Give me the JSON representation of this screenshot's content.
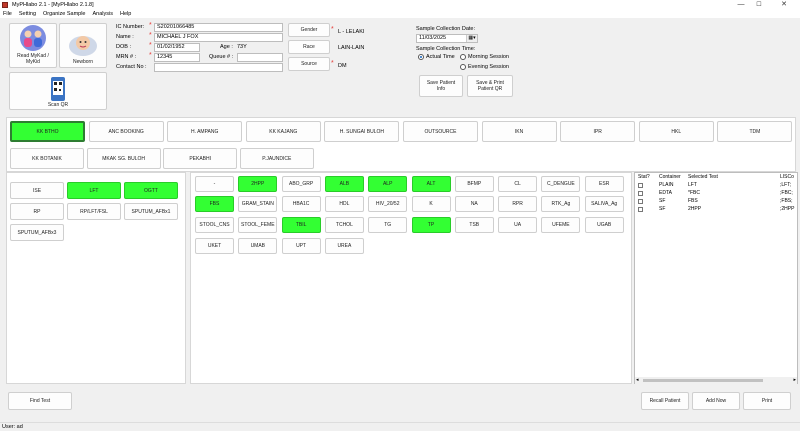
{
  "window": {
    "title": "MyPHlabo 2.1 - [MyPHlabo 2.1.8]",
    "controls": {
      "minimize": "—",
      "maximize": "☐",
      "close": "✕"
    }
  },
  "menu": [
    "File",
    "Setting",
    "Organize Sample",
    "Analysis",
    "Help"
  ],
  "top_buttons": {
    "read_mykad": "Read MyKad / MyKid",
    "newborn": "Newborn",
    "scan_qr": "Scan QR"
  },
  "patient": {
    "ic_label": "IC Number:",
    "ic_value": "S20201066485",
    "name_label": "Name :",
    "name_value": "MICHAEL J FOX",
    "dob_label": "DOB :",
    "dob_value": "01/02/1952",
    "age_label": "Age :",
    "age_value": "73Y",
    "mrn_label": "MRN # :",
    "mrn_value": "12345",
    "queue_label": "Queue # :",
    "queue_value": "",
    "contact_label": "Contact No :",
    "contact_value": ""
  },
  "demographics": {
    "gender_button": "Gender",
    "gender_value": "L - LELAKI",
    "race_button": "Race",
    "race_value": "LAIN-LAIN",
    "source_button": "Source",
    "source_value": "DM"
  },
  "collection": {
    "date_label": "Sample Collection Date:",
    "date_value": "11/03/2025",
    "time_label": "Sample Collection Time:",
    "options": [
      "Actual Time",
      "Morning Session",
      "Evening Session"
    ],
    "selected": "Actual Time"
  },
  "actions": {
    "save_patient": "Save Patient Info",
    "save_print": "Save & Print Patient QR"
  },
  "locations_row1": [
    "KK BTHO",
    "ANC BOOKING",
    "H. AMPANG",
    "KK KAJANG",
    "H. SUNGAI BULOH",
    "OUTSOURCE",
    "IKN",
    "IPR",
    "HKL",
    "TDM"
  ],
  "locations_row2": [
    "KK BOTANIK",
    "MKAK SG. BULOH",
    "PEKABHI",
    "P.JAUNDICE"
  ],
  "selected_location": "KK BTHO",
  "left_tests": [
    "ISE",
    "LFT",
    "OGTT",
    "RP",
    "RP/LFT/FSL",
    "SPUTUM_AFBx1",
    "SPUTUM_AFBx3"
  ],
  "left_tests_selected": [
    "LFT",
    "OGTT"
  ],
  "tests": [
    [
      "-",
      "2HPP",
      "ABO_GRP",
      "ALB",
      "ALP",
      "ALT",
      "BFMP",
      "CL",
      "C_DENGUE",
      "ESR"
    ],
    [
      "FBS",
      "GRAM_STAIN",
      "HBA1C",
      "HDL",
      "HIV_20/52",
      "K",
      "NA",
      "RPR",
      "RTK_Ag",
      "SALIVA_Ag"
    ],
    [
      "STOOL_CNS",
      "STOOL_FEME",
      "TBIL",
      "TCHOL",
      "TG",
      "TP",
      "TSB",
      "UA",
      "UFEME",
      "UGAB"
    ],
    [
      "UKET",
      "UMAB",
      "UPT",
      "UREA"
    ]
  ],
  "tests_selected": [
    "2HPP",
    "ALB",
    "ALP",
    "ALT",
    "FBS",
    "TBIL",
    "TP"
  ],
  "selected_table": {
    "headers": [
      "Stat?",
      "Container",
      "Selected Test",
      "LISCo"
    ],
    "rows": [
      [
        "",
        "PLAIN",
        "LFT",
        ";LFT;"
      ],
      [
        "",
        "EDTA",
        "*FBC",
        ";FBC;"
      ],
      [
        "",
        "SF",
        "FBS",
        ";FBS;"
      ],
      [
        "",
        "SF",
        "2HPP",
        ";2HPP"
      ]
    ]
  },
  "bottom_buttons": {
    "find_test": "Find Test",
    "recall_patient": "Recall Patient",
    "add_now": "Add Now",
    "print": "Print"
  },
  "status": "User: ad"
}
